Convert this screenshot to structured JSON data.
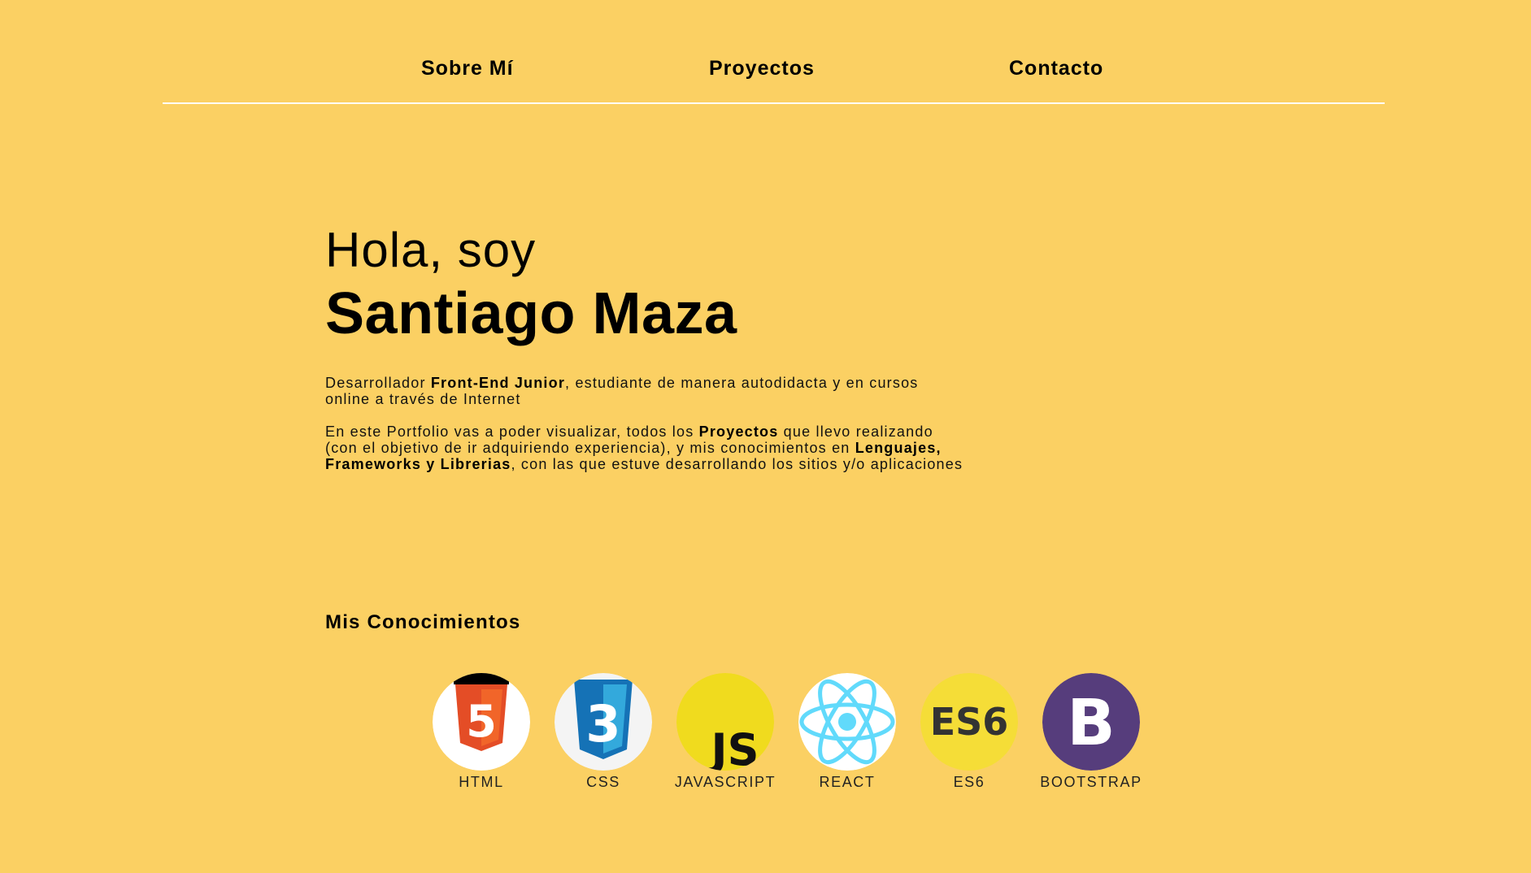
{
  "nav": {
    "items": [
      {
        "label": "Sobre Mí"
      },
      {
        "label": "Proyectos"
      },
      {
        "label": "Contacto"
      }
    ]
  },
  "hero": {
    "greeting": "Hola, soy",
    "name": "Santiago Maza",
    "paragraph1": {
      "t1": "Desarrollador ",
      "b1": "Front-End Junior",
      "t2": ", estudiante de manera autodidacta y en cursos online a través de Internet"
    },
    "paragraph2": {
      "t1": "En este Portfolio vas a poder visualizar, todos los ",
      "b1": "Proyectos",
      "t2": " que llevo realizando (con el objetivo de ir adquiriendo experiencia), y mis conocimientos en ",
      "b2": "Lenguajes, Frameworks y Librerias",
      "t3": ", con las que estuve desarrollando los sitios y/o aplicaciones"
    }
  },
  "skills": {
    "title": "Mis Conocimientos",
    "items": [
      {
        "label": "HTML",
        "icon": "html5-icon",
        "badge": "5",
        "color": "#E44D26"
      },
      {
        "label": "CSS",
        "icon": "css3-icon",
        "badge": "3",
        "color": "#1572B6"
      },
      {
        "label": "JAVASCRIPT",
        "icon": "javascript-icon",
        "badge": "JS",
        "color": "#F0DB1E"
      },
      {
        "label": "REACT",
        "icon": "react-icon",
        "color": "#61DAFB"
      },
      {
        "label": "ES6",
        "icon": "es6-icon",
        "badge": "ES6",
        "color": "#F5DD37"
      },
      {
        "label": "BOOTSTRAP",
        "icon": "bootstrap-icon",
        "badge": "B",
        "color": "#563D7C"
      }
    ]
  },
  "colors": {
    "background": "#FBD063",
    "divider": "#FFFFFF"
  }
}
